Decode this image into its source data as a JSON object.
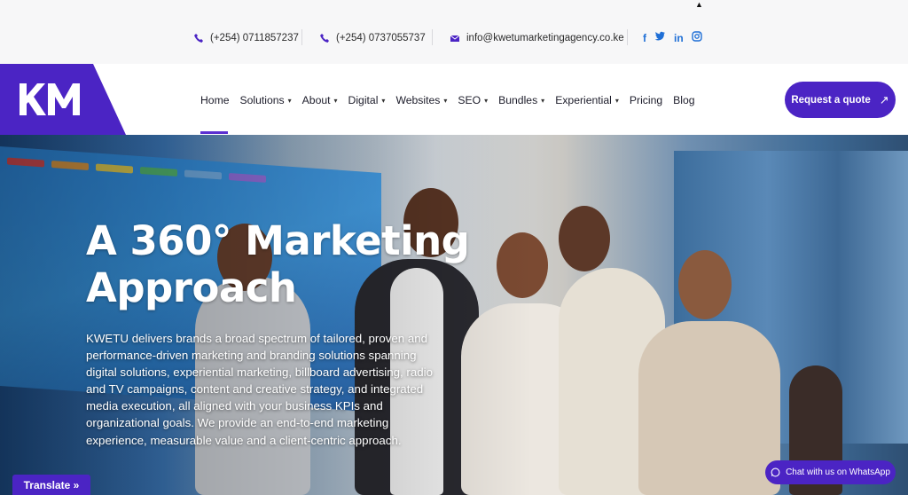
{
  "topbar": {
    "phone1": "(+254) 0711857237",
    "phone2": "(+254) 0737055737",
    "email": "info@kwetumarketingagency.co.ke",
    "social": [
      "f",
      "t",
      "in",
      "ig"
    ]
  },
  "logo": {
    "text": "KM"
  },
  "nav": {
    "items": [
      {
        "label": "Home",
        "dropdown": false
      },
      {
        "label": "Solutions",
        "dropdown": true
      },
      {
        "label": "About",
        "dropdown": true
      },
      {
        "label": "Digital",
        "dropdown": true
      },
      {
        "label": "Websites",
        "dropdown": true
      },
      {
        "label": "SEO",
        "dropdown": true
      },
      {
        "label": "Bundles",
        "dropdown": true
      },
      {
        "label": "Experiential",
        "dropdown": true
      },
      {
        "label": "Pricing",
        "dropdown": false
      },
      {
        "label": "Blog",
        "dropdown": false
      }
    ],
    "active": "Home"
  },
  "cta": {
    "label": "Request a quote"
  },
  "hero": {
    "title": "A 360° Marketing Approach",
    "body": "KWETU delivers brands a broad spectrum of tailored, proven and performance-driven marketing and branding solutions spanning digital solutions, experiential marketing, billboard advertising, radio and TV campaigns, content and creative strategy, and integrated media execution, all aligned with your business KPIs and organizational goals. We provide an end-to-end marketing experience, measurable value and a client-centric approach."
  },
  "translate": {
    "label": "Translate »"
  },
  "whatsapp": {
    "label": "Chat with us on WhatsApp"
  },
  "colors": {
    "accent": "#4b24c4",
    "social": "#1f6fd6",
    "active_underline": "#5b2fd1"
  }
}
